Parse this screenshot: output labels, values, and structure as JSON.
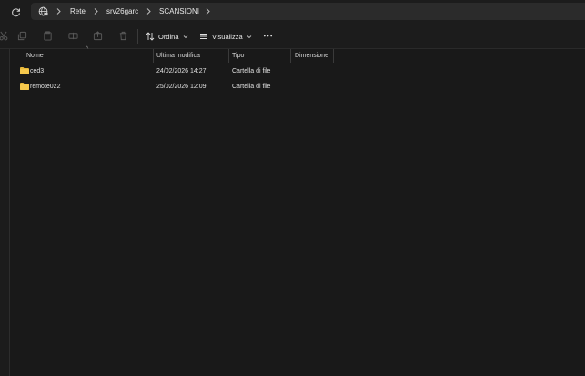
{
  "address": {
    "crumbs": [
      "Rete",
      "srv26garc",
      "SCANSIONI"
    ]
  },
  "toolbar": {
    "sort_label": "Ordina",
    "view_label": "Visualizza"
  },
  "columns": {
    "name": "Nome",
    "modified": "Ultima modifica",
    "type": "Tipo",
    "size": "Dimensione"
  },
  "files": [
    {
      "name": "ced3",
      "modified": "24/02/2026 14:27",
      "type": "Cartella di file",
      "size": ""
    },
    {
      "name": "remote022",
      "modified": "25/02/2026 12:09",
      "type": "Cartella di file",
      "size": ""
    }
  ],
  "colors": {
    "folder": "#e8b83a",
    "background": "#191919",
    "accent": "#4cc2ff"
  }
}
